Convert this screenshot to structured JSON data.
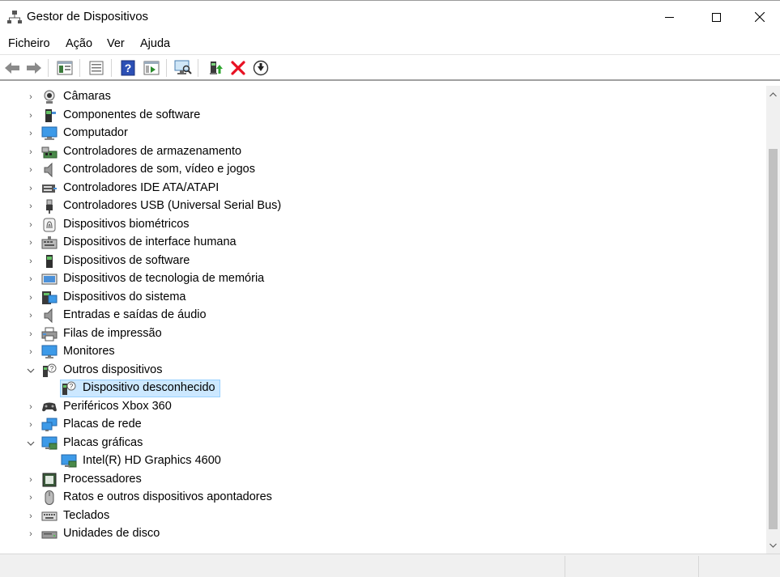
{
  "window": {
    "title": "Gestor de Dispositivos"
  },
  "menu": [
    "Ficheiro",
    "Ação",
    "Ver",
    "Ajuda"
  ],
  "toolbar": {
    "buttons": [
      "back-icon",
      "forward-icon",
      "properties-view-icon",
      "details-icon",
      "help-icon",
      "action-view-icon",
      "scan-hardware-icon",
      "update-driver-icon",
      "uninstall-icon",
      "disable-icon"
    ]
  },
  "tree": {
    "items": [
      {
        "label": "Câmaras",
        "icon": "camera-icon",
        "expanded": false
      },
      {
        "label": "Componentes de software",
        "icon": "software-component-icon",
        "expanded": false
      },
      {
        "label": "Computador",
        "icon": "computer-icon",
        "expanded": false
      },
      {
        "label": "Controladores de armazenamento",
        "icon": "storage-controller-icon",
        "expanded": false
      },
      {
        "label": "Controladores de som, vídeo e jogos",
        "icon": "speaker-icon",
        "expanded": false
      },
      {
        "label": "Controladores IDE ATA/ATAPI",
        "icon": "ide-icon",
        "expanded": false
      },
      {
        "label": "Controladores USB (Universal Serial Bus)",
        "icon": "usb-icon",
        "expanded": false
      },
      {
        "label": "Dispositivos biométricos",
        "icon": "fingerprint-icon",
        "expanded": false
      },
      {
        "label": "Dispositivos de interface humana",
        "icon": "hid-icon",
        "expanded": false
      },
      {
        "label": "Dispositivos de software",
        "icon": "software-device-icon",
        "expanded": false
      },
      {
        "label": "Dispositivos de tecnologia de memória",
        "icon": "memory-icon",
        "expanded": false
      },
      {
        "label": "Dispositivos do sistema",
        "icon": "system-device-icon",
        "expanded": false
      },
      {
        "label": "Entradas e saídas de áudio",
        "icon": "audio-io-icon",
        "expanded": false
      },
      {
        "label": "Filas de impressão",
        "icon": "printer-icon",
        "expanded": false
      },
      {
        "label": "Monitores",
        "icon": "monitor-icon",
        "expanded": false
      },
      {
        "label": "Outros dispositivos",
        "icon": "other-devices-icon",
        "expanded": true,
        "children": [
          {
            "label": "Dispositivo desconhecido",
            "icon": "unknown-device-icon",
            "selected": true
          }
        ]
      },
      {
        "label": "Periféricos Xbox 360",
        "icon": "gamepad-icon",
        "expanded": false
      },
      {
        "label": "Placas de rede",
        "icon": "network-adapter-icon",
        "expanded": false
      },
      {
        "label": "Placas gráficas",
        "icon": "display-adapter-icon",
        "expanded": true,
        "children": [
          {
            "label": "Intel(R) HD Graphics 4600",
            "icon": "display-adapter-icon",
            "selected": false
          }
        ]
      },
      {
        "label": "Processadores",
        "icon": "processor-icon",
        "expanded": false
      },
      {
        "label": "Ratos e outros dispositivos apontadores",
        "icon": "mouse-icon",
        "expanded": false
      },
      {
        "label": "Teclados",
        "icon": "keyboard-icon",
        "expanded": false
      },
      {
        "label": "Unidades de disco",
        "icon": "disk-drive-icon",
        "expanded": false
      }
    ]
  },
  "colors": {
    "selection": "#cce8ff",
    "selection_border": "#99d1ff",
    "uninstall_red": "#e81123"
  }
}
